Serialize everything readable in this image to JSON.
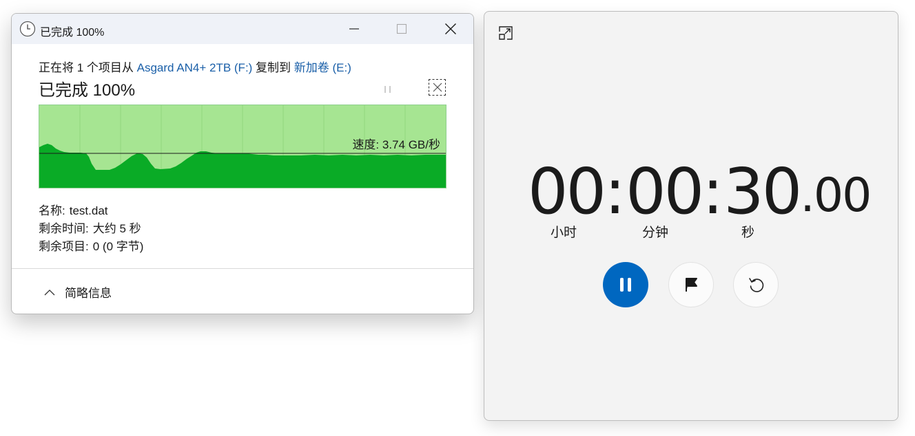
{
  "copy_dialog": {
    "title": "已完成 100%",
    "line_prefix": "正在将 1 个项目从 ",
    "source": "Asgard AN4+ 2TB (F:)",
    "line_middle": " 复制到 ",
    "destination": "新加卷 (E:)",
    "status": "已完成 100%",
    "speed_label": "速度: ",
    "speed_value": "3.74 GB/秒",
    "name_label": "名称:",
    "name_value": "test.dat",
    "time_label": "剩余时间:",
    "time_value": "大约 5 秒",
    "items_label": "剩余项目:",
    "items_value": "0 (0 字节)",
    "details_label": "简略信息",
    "progress_percent": 100
  },
  "stopwatch": {
    "hours": "00",
    "minutes": "00",
    "seconds": "30",
    "hundredths": ".00",
    "sep": ":",
    "hours_label": "小时",
    "minutes_label": "分钟",
    "seconds_label": "秒"
  },
  "colors": {
    "graph_fill": "#0aab26",
    "graph_bg": "#a6e592",
    "accent": "#0067c0",
    "link": "#1a5fa8"
  },
  "icons": [
    "clock-icon",
    "minimize-icon",
    "maximize-icon",
    "close-icon",
    "pause-icon",
    "cancel-icon",
    "chevron-up-icon",
    "restore-compact-icon",
    "pause-icon",
    "flag-icon",
    "reset-icon"
  ]
}
